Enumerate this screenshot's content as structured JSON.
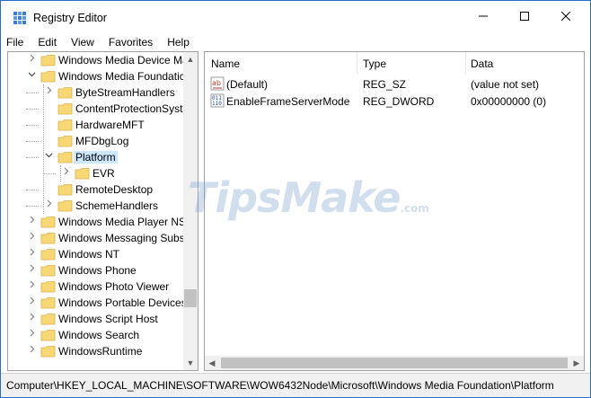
{
  "window": {
    "title": "Registry Editor",
    "controls": {
      "minimize": "minimize",
      "maximize": "maximize",
      "close": "close"
    }
  },
  "menu": [
    "File",
    "Edit",
    "View",
    "Favorites",
    "Help"
  ],
  "tree": {
    "items": [
      {
        "label": "Windows Media Device Ma",
        "depth": 0,
        "expander": "collapsed"
      },
      {
        "label": "Windows Media Foundatic",
        "depth": 0,
        "expander": "expanded"
      },
      {
        "label": "ByteStreamHandlers",
        "depth": 1,
        "expander": "collapsed"
      },
      {
        "label": "ContentProtectionSyste",
        "depth": 1,
        "expander": "none"
      },
      {
        "label": "HardwareMFT",
        "depth": 1,
        "expander": "none"
      },
      {
        "label": "MFDbgLog",
        "depth": 1,
        "expander": "none"
      },
      {
        "label": "Platform",
        "depth": 1,
        "expander": "expanded",
        "selected": true
      },
      {
        "label": "EVR",
        "depth": 2,
        "expander": "collapsed"
      },
      {
        "label": "RemoteDesktop",
        "depth": 1,
        "expander": "none"
      },
      {
        "label": "SchemeHandlers",
        "depth": 1,
        "expander": "collapsed"
      },
      {
        "label": "Windows Media Player NSS",
        "depth": 0,
        "expander": "collapsed"
      },
      {
        "label": "Windows Messaging Subsy",
        "depth": 0,
        "expander": "collapsed"
      },
      {
        "label": "Windows NT",
        "depth": 0,
        "expander": "collapsed"
      },
      {
        "label": "Windows Phone",
        "depth": 0,
        "expander": "collapsed"
      },
      {
        "label": "Windows Photo Viewer",
        "depth": 0,
        "expander": "collapsed"
      },
      {
        "label": "Windows Portable Devices",
        "depth": 0,
        "expander": "collapsed"
      },
      {
        "label": "Windows Script Host",
        "depth": 0,
        "expander": "collapsed"
      },
      {
        "label": "Windows Search",
        "depth": 0,
        "expander": "collapsed"
      },
      {
        "label": "WindowsRuntime",
        "depth": 0,
        "expander": "collapsed"
      }
    ]
  },
  "list": {
    "columns": [
      "Name",
      "Type",
      "Data"
    ],
    "rows": [
      {
        "icon": "string-value-icon",
        "name": "(Default)",
        "type": "REG_SZ",
        "data": "(value not set)"
      },
      {
        "icon": "binary-value-icon",
        "name": "EnableFrameServerMode",
        "type": "REG_DWORD",
        "data": "0x00000000 (0)"
      }
    ]
  },
  "status": {
    "path": "Computer\\HKEY_LOCAL_MACHINE\\SOFTWARE\\WOW6432Node\\Microsoft\\Windows Media Foundation\\Platform"
  },
  "watermark": {
    "brand": "TipsMake",
    "suffix": ".com"
  },
  "colors": {
    "selection": "#cce8ff",
    "folder": "#f8d775",
    "border": "#a0a0a0",
    "watermark": "#78a0cd"
  }
}
